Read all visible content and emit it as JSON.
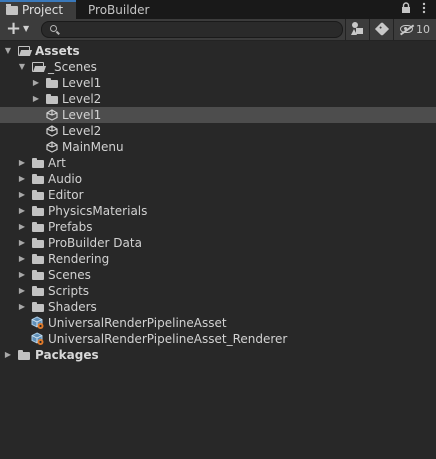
{
  "tabs": [
    {
      "label": "Project",
      "active": true
    },
    {
      "label": "ProBuilder",
      "active": false
    }
  ],
  "tab_icons": [
    "lock-icon",
    "menu-dots-icon"
  ],
  "toolbar": {
    "create_label": "+",
    "search": {
      "value": "",
      "placeholder": ""
    },
    "hidden_count": "10"
  },
  "colors": {
    "accent": "#3a79bb",
    "selected_row": "#4d4d4d",
    "background": "#282828"
  },
  "tree": {
    "assets_label": "Assets",
    "scenes_folder_label": "_Scenes",
    "scenes_subfolders": [
      "Level1",
      "Level2"
    ],
    "scene_files": [
      "Level1",
      "Level2",
      "MainMenu"
    ],
    "selected_scene_index": 0,
    "folders": [
      "Art",
      "Audio",
      "Editor",
      "PhysicsMaterials",
      "Prefabs",
      "ProBuilder Data",
      "Rendering",
      "Scenes",
      "Scripts",
      "Shaders"
    ],
    "asset_files": [
      "UniversalRenderPipelineAsset",
      "UniversalRenderPipelineAsset_Renderer"
    ],
    "packages_label": "Packages"
  }
}
